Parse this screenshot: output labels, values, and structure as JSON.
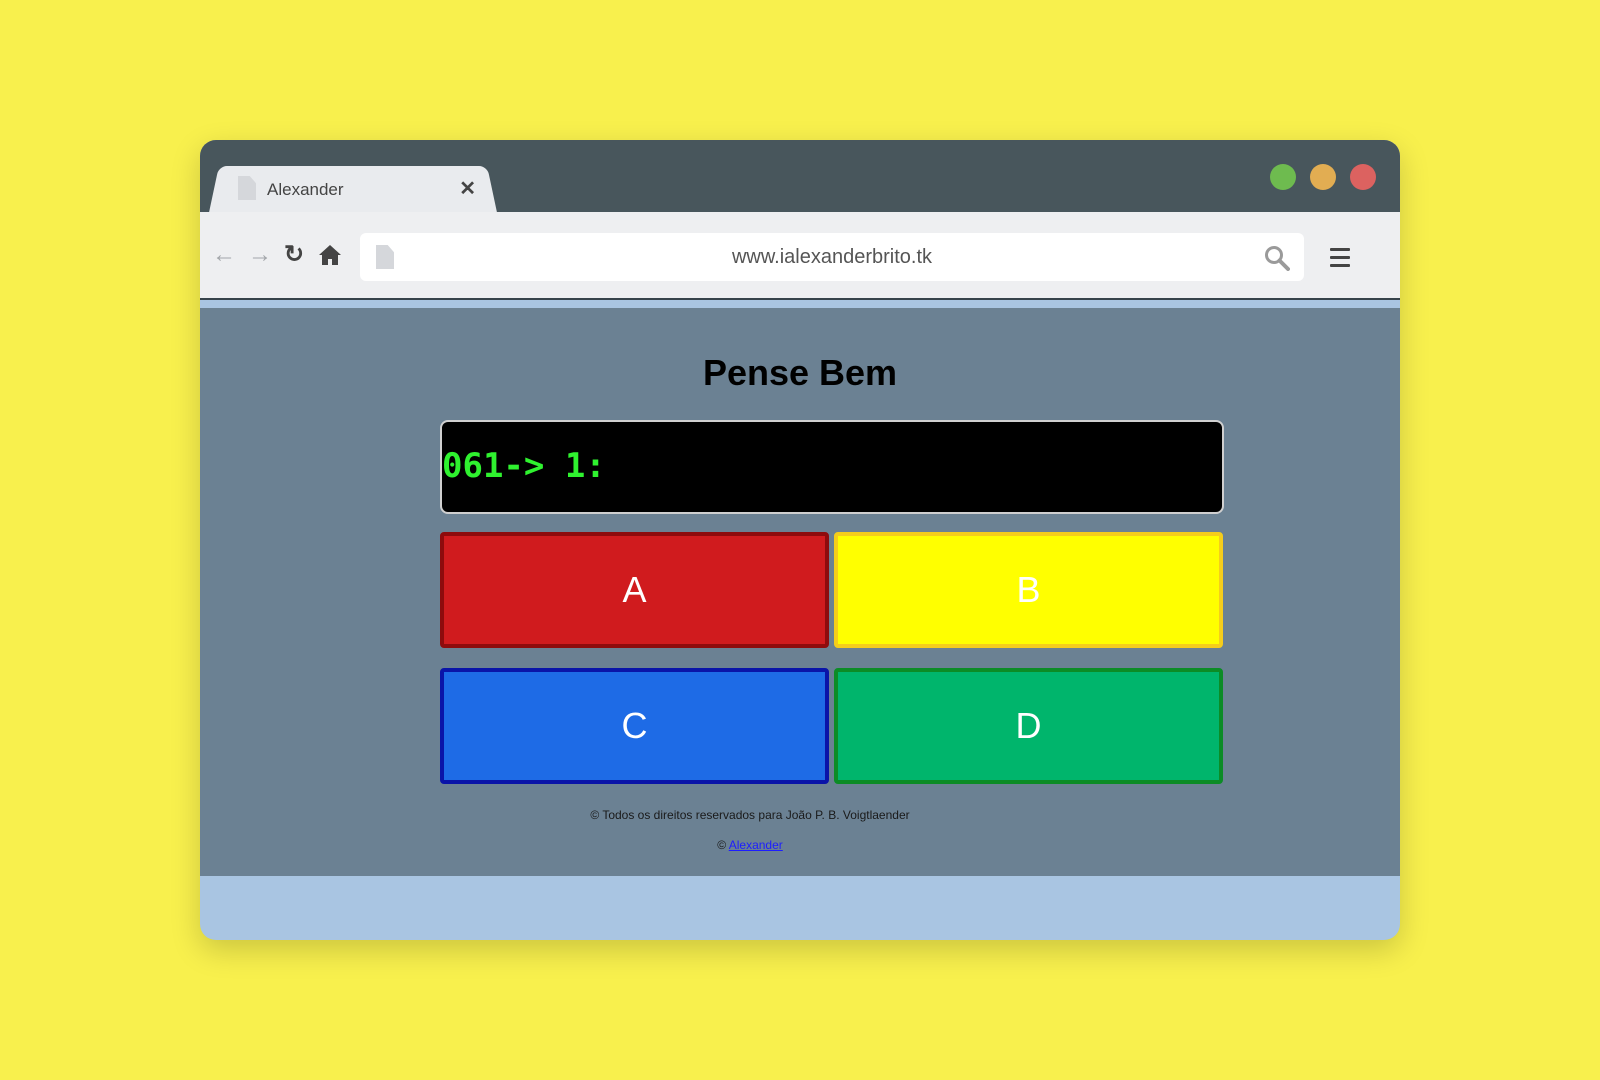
{
  "browser": {
    "tab_title": "Alexander",
    "tab_close": "✕",
    "url": "www.ialexanderbrito.tk",
    "nav_back": "←",
    "nav_forward": "→",
    "nav_reload": "↻"
  },
  "colors": {
    "background": "#f8f04d",
    "titlebar": "#48565c",
    "page": "#6b8193",
    "btn_a": "#d01b1e",
    "btn_b": "#ffff00",
    "btn_c": "#1e6be6",
    "btn_d": "#00b56c",
    "display_text": "#2ff22f"
  },
  "page": {
    "title": "Pense Bem",
    "display": "061-> 1:",
    "buttons": {
      "a": "A",
      "b": "B",
      "c": "C",
      "d": "D"
    },
    "footer": {
      "copyright": "© Todos os direitos reservados para João P. B. Voigtlaender",
      "credit_prefix": "©",
      "credit_link": "Alexander"
    }
  }
}
